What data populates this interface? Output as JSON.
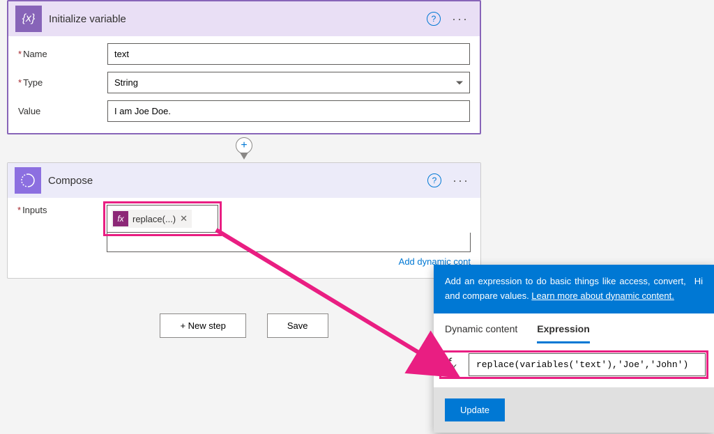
{
  "actions": {
    "initVar": {
      "title": "Initialize variable",
      "fields": {
        "nameLabel": "Name",
        "nameValue": "text",
        "typeLabel": "Type",
        "typeValue": "String",
        "valueLabel": "Value",
        "valueValue": "I am Joe Doe."
      }
    },
    "compose": {
      "title": "Compose",
      "inputsLabel": "Inputs",
      "token": "replace(...)",
      "addDynamic": "Add dynamic cont"
    }
  },
  "buttons": {
    "newStep": "+ New step",
    "save": "Save"
  },
  "popup": {
    "bannerText": "Add an expression to do basic things like access, convert, and compare values. ",
    "bannerLink": "Learn more about dynamic content.",
    "bannerHide": "Hi",
    "tabs": {
      "dynamic": "Dynamic content",
      "expression": "Expression"
    },
    "expression": "replace(variables('text'),'Joe','John')",
    "updateBtn": "Update"
  }
}
